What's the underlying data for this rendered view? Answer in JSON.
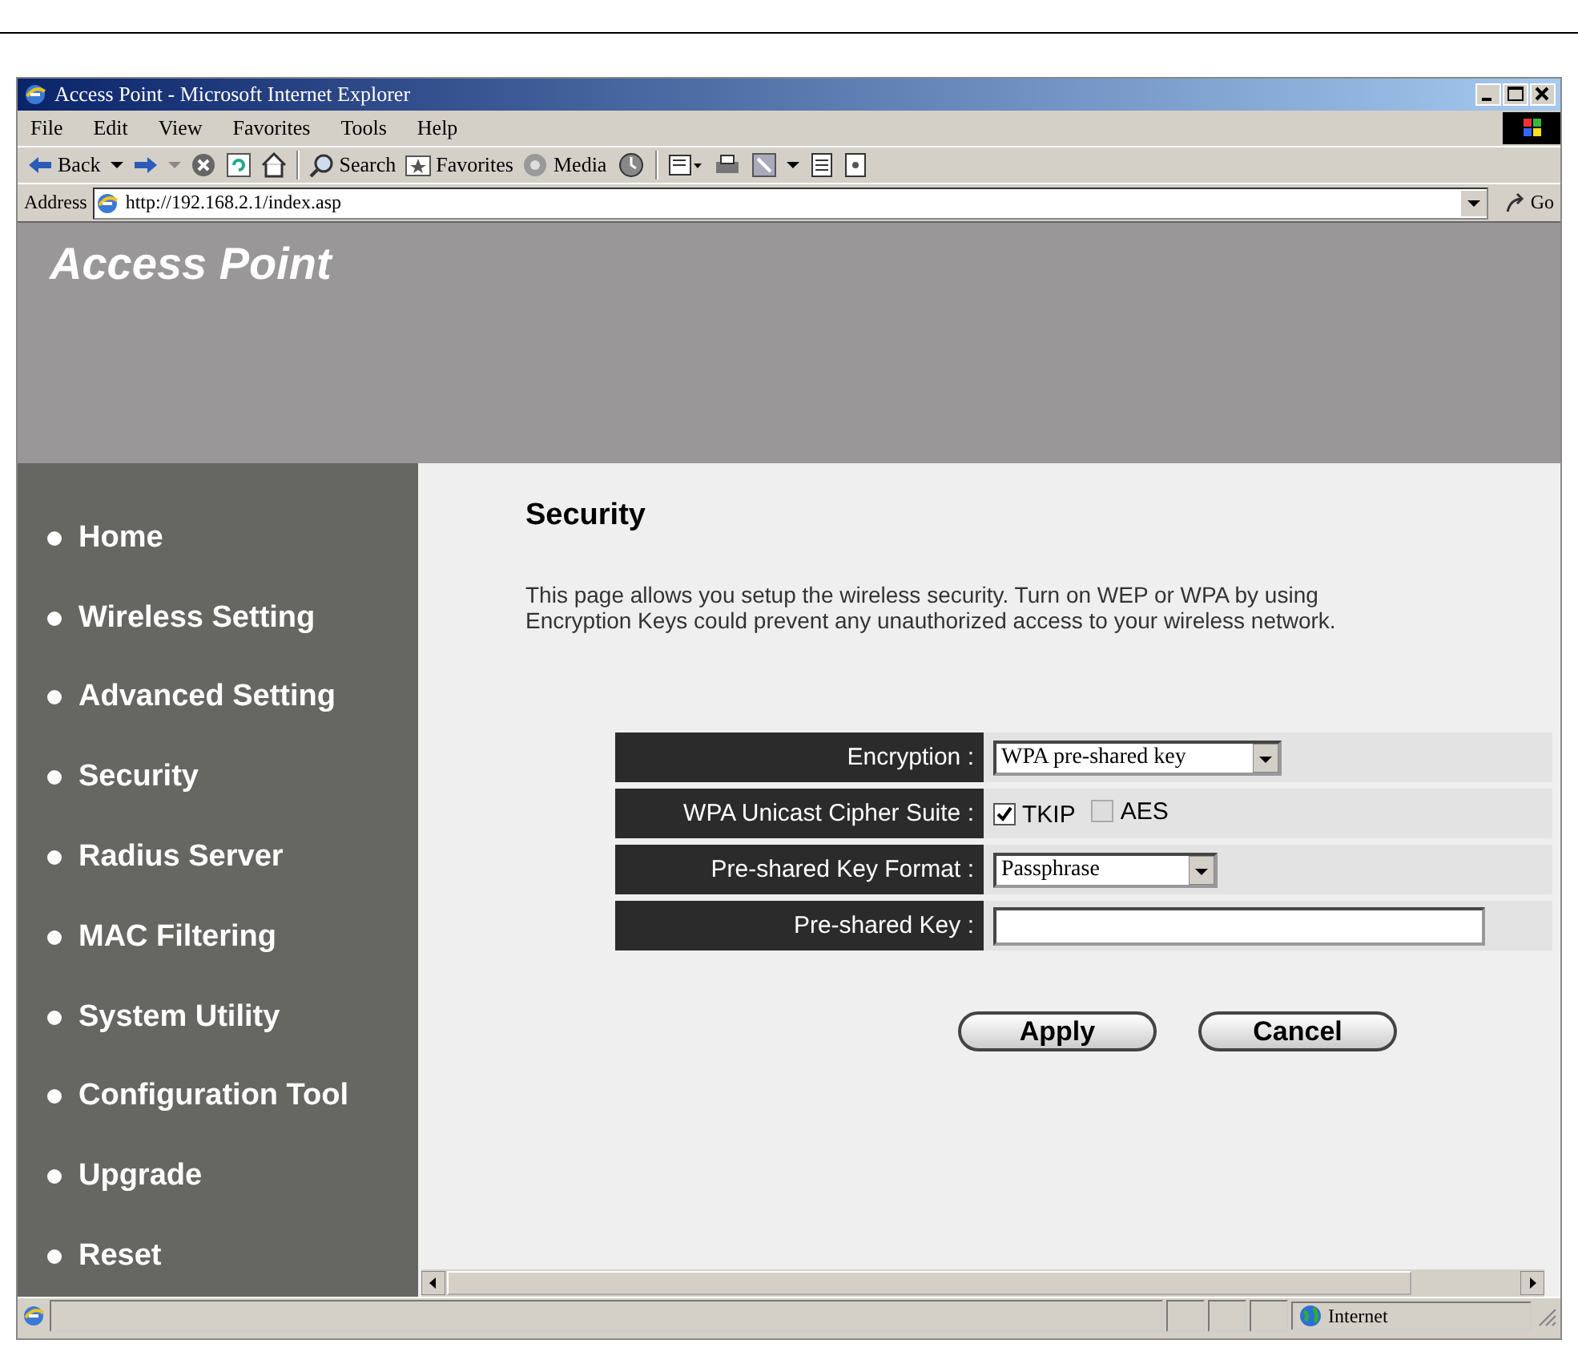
{
  "window": {
    "title": "Access Point - Microsoft Internet Explorer"
  },
  "menu": [
    "File",
    "Edit",
    "View",
    "Favorites",
    "Tools",
    "Help"
  ],
  "toolbar": {
    "back": "Back",
    "search": "Search",
    "favorites": "Favorites",
    "media": "Media"
  },
  "address": {
    "label": "Address",
    "url": "http://192.168.2.1/index.asp",
    "go": "Go"
  },
  "page": {
    "brand": "Access Point",
    "nav": [
      {
        "label": "Home"
      },
      {
        "label": "Wireless Setting"
      },
      {
        "label": "Advanced Setting"
      },
      {
        "label": "Security"
      },
      {
        "label": "Radius Server"
      },
      {
        "label": "MAC Filtering"
      },
      {
        "label": "System Utility"
      },
      {
        "label": "Configuration Tool"
      },
      {
        "label": "Upgrade"
      },
      {
        "label": "Reset"
      }
    ],
    "title": "Security",
    "description": "This page allows you setup the wireless security. Turn on WEP or WPA by using Encryption Keys could prevent any unauthorized access to your wireless network.",
    "form": {
      "rows": [
        {
          "kind": "select",
          "label": "Encryption :",
          "value": "WPA pre-shared key"
        },
        {
          "kind": "checkboxes",
          "label": "WPA Unicast Cipher Suite :",
          "options": [
            {
              "label": "TKIP",
              "checked": true
            },
            {
              "label": "AES",
              "checked": false
            }
          ]
        },
        {
          "kind": "select",
          "label": "Pre-shared Key Format :",
          "value": "Passphrase"
        },
        {
          "kind": "text",
          "label": "Pre-shared Key :"
        }
      ]
    },
    "buttons": [
      "Apply",
      "Cancel"
    ]
  },
  "status_bar": {
    "zone": "Internet"
  }
}
